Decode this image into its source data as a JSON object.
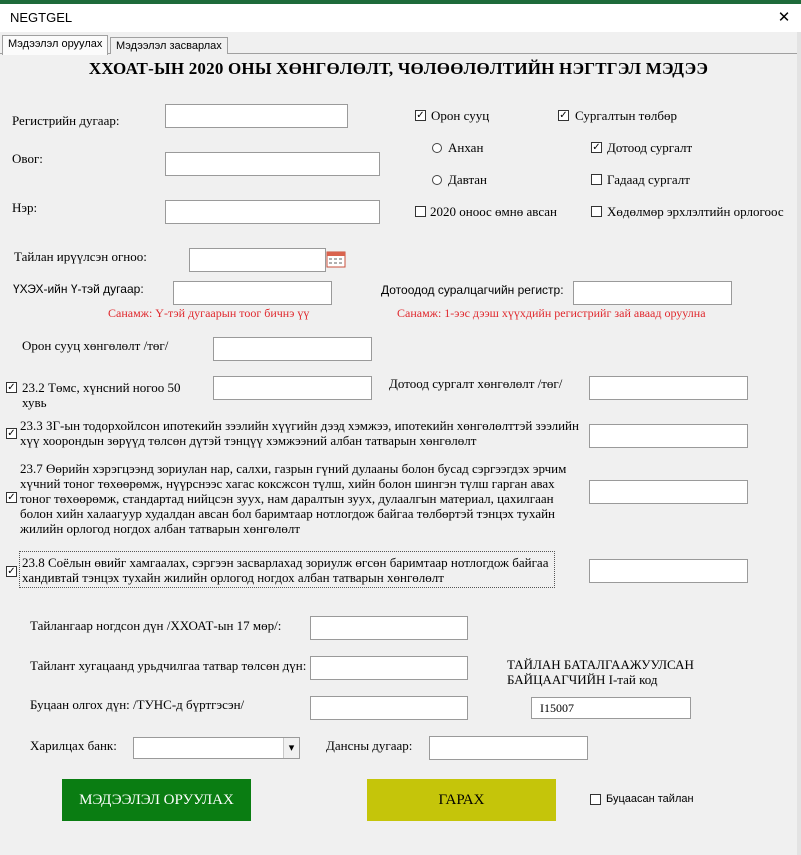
{
  "window": {
    "title": "NEGTGEL",
    "close_glyph": "✕"
  },
  "tabs": [
    {
      "label": "Мэдээлэл оруулах",
      "active": true
    },
    {
      "label": "Мэдээлэл засварлах",
      "active": false
    }
  ],
  "heading": "ХХОАТ-ЫН 2020 ОНЫ ХӨНГӨЛӨЛТ, ЧӨЛӨӨЛӨЛТИЙН НЭГТГЭЛ МЭДЭЭ",
  "fields": {
    "register": {
      "label": "Регистрийн дугаар:",
      "value": ""
    },
    "surname": {
      "label": "Овог:",
      "value": ""
    },
    "name": {
      "label": "Нэр:",
      "value": ""
    },
    "report_date": {
      "label": "Тайлан ирүүлсэн огноо:",
      "value": ""
    },
    "ukhekh": {
      "label": "ҮХЭХ-ийн Ү-тэй дугаар:",
      "value": "",
      "warning": "Санамж: Ү-тэй дугаарын тоог бичнэ үү"
    },
    "domestic_register": {
      "label": "Дотоодод суралцагчийн регистр:",
      "value": "",
      "warning": "Санамж: 1-ээс дээш хүүхдийн регистрийг зай аваад оруулна"
    },
    "housing_discount": {
      "label": "Орон сууц хөнгөлөлт /төг/",
      "value": ""
    },
    "domestic_study_discount": {
      "label": "Дотоод сургалт хөнгөлөлт /төг/",
      "value": ""
    }
  },
  "right_options": {
    "housing": {
      "label": "Орон сууц",
      "checked": true
    },
    "first": {
      "label": "Анхан",
      "selected": false
    },
    "second": {
      "label": "Давтан",
      "selected": false
    },
    "before_2020": {
      "label": "2020 оноос өмнө авсан",
      "checked": false
    },
    "tuition": {
      "label": "Сургалтын төлбөр",
      "checked": true
    },
    "domestic_study": {
      "label": "Дотоод сургалт",
      "checked": true
    },
    "foreign_study": {
      "label": "Гадаад сургалт",
      "checked": false
    },
    "labor_income": {
      "label": "Хөдөлмөр эрхлэлтийн орлогоос",
      "checked": false
    }
  },
  "articles": [
    {
      "text": "23.2 Төмс, хүнсний ногоо 50 хувь",
      "checked": true,
      "value": ""
    },
    {
      "text": "23.3 ЗГ-ын тодорхойлсон ипотекийн зээлийн хүүгийн дээд хэмжээ, ипотекийн хөнгөлөлттэй зээлийн хүү хоорондын зөрүүд төлсөн дүтэй тэнцүү хэмжээний албан татварын хөнгөлөлт",
      "checked": true,
      "value": ""
    },
    {
      "text": "23.7 Өөрийн хэрэгцээнд зориулан нар, салхи, газрын гүний дулааны болон бусад сэргээгдэх эрчим хүчний тоног төхөөрөмж, нүүрснээс хагас коксжсон түлш, хийн болон шингэн түлш гарган авах тоног төхөөрөмж, стандартад нийцсэн зуух, нам даралтын зуух, дулаалгын материал, цахилгаан болон хийн халаагуур худалдан авсан бол баримтаар нотлогдож байгаа төлбөртэй тэнцэх тухайн жилийн орлогод ногдох албан татварын хөнгөлөлт",
      "checked": true,
      "value": ""
    },
    {
      "text": "23.8 Соёлын өвийг хамгаалах, сэргээн засварлахад зориулж өгсөн баримтаар нотлогдож байгаа хандивтай тэнцэх тухайн жилийн орлогод ногдох албан татварын хөнгөлөлт",
      "checked": true,
      "value": ""
    }
  ],
  "totals": {
    "assessed": {
      "label": "Тайлангаар ногдсон дүн /ХХОАТ-ын 17 мөр/:",
      "value": ""
    },
    "prepaid": {
      "label": "Тайлант хугацаанд урьдчилгаа татвар төлсөн дүн:",
      "value": ""
    },
    "refund": {
      "label": "Буцаан олгох дүн: /ТУНС-д бүртгэсэн/",
      "value": ""
    }
  },
  "inspector": {
    "label": "ТАЙЛАН БАТАЛГААЖУУЛСАН БАЙЦААГЧИЙН I-тай код",
    "value": "I15007"
  },
  "bank": {
    "label": "Харилцах банк:",
    "value": "",
    "dropdown_glyph": "▾"
  },
  "account": {
    "label": "Дансны дугаар:",
    "value": ""
  },
  "buttons": {
    "submit": {
      "label": "МЭДЭЭЛЭЛ ОРУУЛАХ",
      "color": "#0a7d12"
    },
    "exit": {
      "label": "ГАРАХ",
      "color": "#c5c50a"
    }
  },
  "returned_report": {
    "label": "Буцаасан тайлан",
    "checked": false
  },
  "check_glyph": "✓",
  "icons": {
    "calendar": "calendar-icon",
    "close": "close-icon",
    "dropdown": "chevron-down-icon"
  },
  "colors": {
    "warning": "#e0282d",
    "title_strip": "#1e6b3a"
  }
}
